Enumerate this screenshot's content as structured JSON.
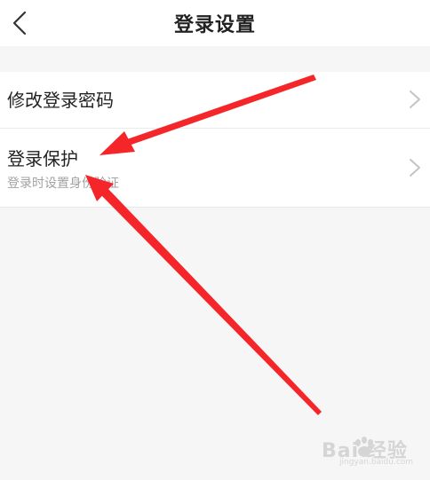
{
  "header": {
    "title": "登录设置"
  },
  "settings": {
    "items": [
      {
        "label": "修改登录密码"
      },
      {
        "label": "登录保护",
        "sublabel": "登录时设置身份验证"
      }
    ]
  },
  "colors": {
    "background": "#f6f6f6",
    "surface": "#ffffff",
    "text_primary": "#222222",
    "text_secondary": "#a2a2a2",
    "chevron": "#c4c4c4",
    "annotation_arrow": "#f5262a"
  },
  "icons": {
    "back": "back-chevron-icon",
    "row_arrow": "chevron-right-icon"
  },
  "watermark": {
    "brand": "Bai 经验",
    "url": "jingyan.baidu.com"
  }
}
